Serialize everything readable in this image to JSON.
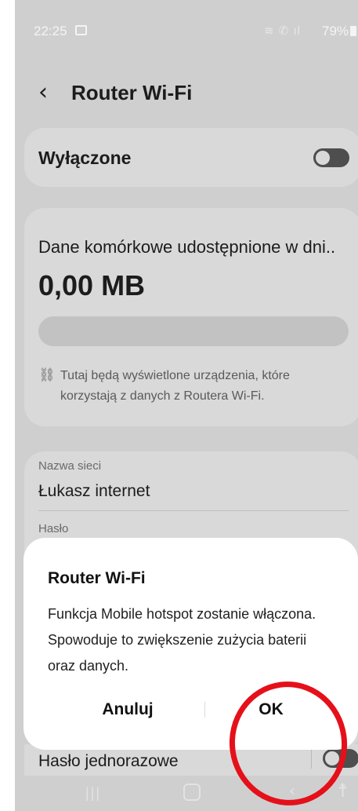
{
  "status_bar": {
    "time": "22:25",
    "signal_icons": "≋ ✆ ıl",
    "battery": "79%",
    "icons": [
      "image-icon",
      "wifi-call-icon",
      "signal-icon",
      "battery-icon"
    ]
  },
  "header": {
    "back_glyph": "‹",
    "title": "Router Wi-Fi"
  },
  "hotspot_toggle": {
    "label": "Wyłączone",
    "state": "off"
  },
  "usage": {
    "label": "Dane komórkowe udostępnione w dni..",
    "value": "0,00 MB",
    "progress_fraction": 0.0,
    "info": "Tutaj będą wyświetlone urządzenia, które korzystają z danych z Routera Wi-Fi."
  },
  "network": {
    "name_label": "Nazwa sieci",
    "name_value": "Łukasz internet",
    "password_label": "Hasło",
    "otp_label": "Hasło jednorazowe",
    "otp_state": "off"
  },
  "dialog": {
    "title": "Router Wi-Fi",
    "message": "Funkcja Mobile hotspot zostanie włączona. Spowoduje to zwiększenie zużycia baterii oraz danych.",
    "cancel_label": "Anuluj",
    "ok_label": "OK"
  },
  "nav_bar": {
    "recents_glyph": "|||",
    "back_glyph": "‹",
    "accessibility_glyph": "☨"
  },
  "colors": {
    "scrim_background": "#cfcfcf",
    "dialog_background": "#ffffff",
    "annotation_circle": "#e5101a"
  }
}
